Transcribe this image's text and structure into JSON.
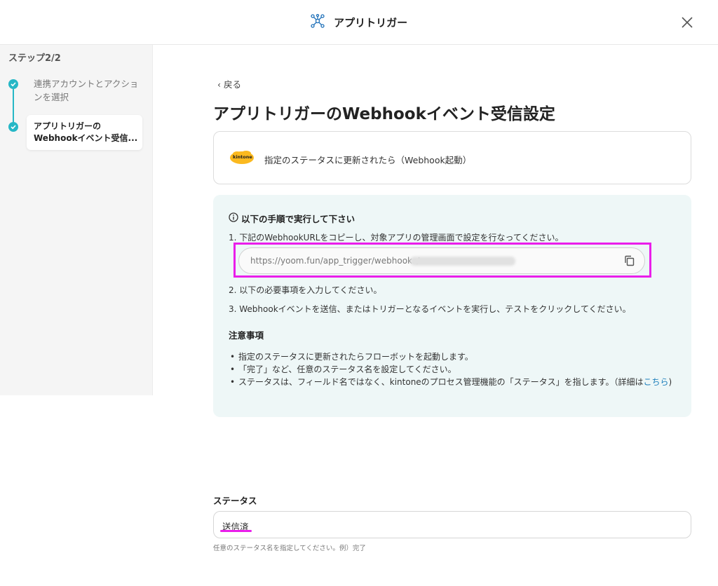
{
  "header": {
    "title": "アプリトリガー",
    "logo_icon": "network-icon",
    "close_icon": "close-icon"
  },
  "sidebar": {
    "step_count": "ステップ2/2",
    "steps": [
      {
        "label": "連携アカウントとアクションを選択",
        "status": "done"
      },
      {
        "label": "アプリトリガーの Webhookイベント受信...",
        "status": "current"
      }
    ]
  },
  "main": {
    "back_label": "戻る",
    "title": "アプリトリガーのWebhookイベント受信設定",
    "trigger": {
      "app_logo_text": "kintone",
      "text": "指定のステータスに更新されたら（Webhook起動）"
    },
    "info": {
      "title": "以下の手順で実行して下さい",
      "step1": "1. 下記のWebhookURLをコピーし、対象アプリの管理画面で設定を行なってください。",
      "url": "https://yoom.fun/app_trigger/webhooks/",
      "step2": "2. 以下の必要事項を入力してください。",
      "step3": "3. Webhookイベントを送信、またはトリガーとなるイベントを実行し、テストをクリックしてください。",
      "notes_title": "注意事項",
      "notes": [
        "指定のステータスに更新されたらフローボットを起動します。",
        "「完了」など、任意のステータス名を設定してください。"
      ],
      "note3_text": "ステータスは、フィールド名ではなく、kintoneのプロセス管理機能の「ステータス」を指します。（詳細は",
      "note3_link": "こちら",
      "note3_end": ")"
    },
    "status": {
      "label": "ステータス",
      "value": "送信済",
      "help": "任意のステータス名を指定してください。例）完了"
    }
  },
  "colors": {
    "accent": "#26b7c6",
    "highlight": "#e91eea",
    "link": "#1a7dbb",
    "info_bg": "#eef7f7"
  }
}
